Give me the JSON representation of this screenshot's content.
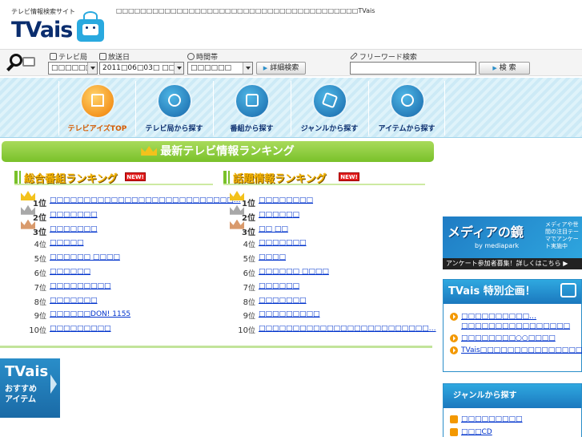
{
  "header": {
    "tagline": "テレビ情報検索サイト",
    "logo_text": "TVais",
    "site_description": "□□□□□□□□□□□□□□□□□□□□□□□□□□□□□□□□□□□□□□□□TVais"
  },
  "search": {
    "station_label": "テレビ局",
    "station_value": "□□□□□□",
    "date_label": "放送日",
    "date_value": "2011□06□03□ □□□",
    "time_label": "時間帯",
    "time_value": "□□□□□□",
    "detail_button": "詳細検索",
    "freeword_label": "フリーワード検索",
    "freeword_value": "",
    "search_button": "検 索"
  },
  "nav": [
    {
      "label": "テレビアイズTOP"
    },
    {
      "label": "テレビ局から探す"
    },
    {
      "label": "番組から探す"
    },
    {
      "label": "ジャンルから探す"
    },
    {
      "label": "アイテムから探す"
    }
  ],
  "ranking": {
    "banner": "最新テレビ情報ランキング",
    "left": {
      "title": "総合番組ランキング",
      "new_badge": "NEW!",
      "items": [
        {
          "rank": "1",
          "suffix": "位",
          "title": "□□□□□□□□□□□□□□□□□□□□□□□□□□□…"
        },
        {
          "rank": "2",
          "suffix": "位",
          "title": "□□□□□□□"
        },
        {
          "rank": "3",
          "suffix": "位",
          "title": "□□□□□□□"
        },
        {
          "rank": "4",
          "suffix": "位",
          "title": "□□□□□"
        },
        {
          "rank": "5",
          "suffix": "位",
          "title": "□□□□□□ □□□□"
        },
        {
          "rank": "6",
          "suffix": "位",
          "title": "□□□□□□"
        },
        {
          "rank": "7",
          "suffix": "位",
          "title": "□□□□□□□□□"
        },
        {
          "rank": "8",
          "suffix": "位",
          "title": "□□□□□□□"
        },
        {
          "rank": "9",
          "suffix": "位",
          "title": "□□□□□□DON! 1155"
        },
        {
          "rank": "10",
          "suffix": "位",
          "title": "□□□□□□□□□"
        }
      ]
    },
    "right": {
      "title": "話題情報ランキング",
      "new_badge": "NEW!",
      "items": [
        {
          "rank": "1",
          "suffix": "位",
          "title": "□□□□□□□□"
        },
        {
          "rank": "2",
          "suffix": "位",
          "title": "□□□□□□"
        },
        {
          "rank": "3",
          "suffix": "位",
          "title": "□□ □□"
        },
        {
          "rank": "4",
          "suffix": "位",
          "title": "□□□□□□□"
        },
        {
          "rank": "5",
          "suffix": "位",
          "title": "□□□□"
        },
        {
          "rank": "6",
          "suffix": "位",
          "title": "□□□□□□ □□□□"
        },
        {
          "rank": "7",
          "suffix": "位",
          "title": "□□□□□□"
        },
        {
          "rank": "8",
          "suffix": "位",
          "title": "□□□□□□□"
        },
        {
          "rank": "9",
          "suffix": "位",
          "title": "□□□□□□□□□"
        },
        {
          "rank": "10",
          "suffix": "位",
          "title": "□□□□□□□□□□□□□□□□□□□□□□□□□…"
        }
      ]
    }
  },
  "recommend": {
    "title": "TVais",
    "line1": "おすすめ",
    "line2": "アイテム"
  },
  "ad_media": {
    "headline": "メディアの鏡",
    "by": "by mediapark",
    "side_text": "メディアや世間の注目テーマでアンケート実施中",
    "footer": "アンケート参加者募集！詳しくはこちら ▶"
  },
  "special": {
    "title": "TVais 特別企画！",
    "links": [
      {
        "text": "□□□□□□□□□□…□□□□□□□□□□□□□□□□"
      },
      {
        "text": "□□□□□□□□○○□□□□"
      },
      {
        "text": "TVais□□□□□□□□□□□□□□□□□□"
      }
    ]
  },
  "genre": {
    "title": "ジャンルから探す",
    "links": [
      {
        "text": "□□□□□□□□□"
      },
      {
        "text": "□□□CD"
      }
    ]
  },
  "colors": {
    "brand_blue": "#2a8ec9",
    "ranking_green": "#79c12a",
    "link_blue": "#0033cc",
    "active_orange": "#f07b00"
  }
}
